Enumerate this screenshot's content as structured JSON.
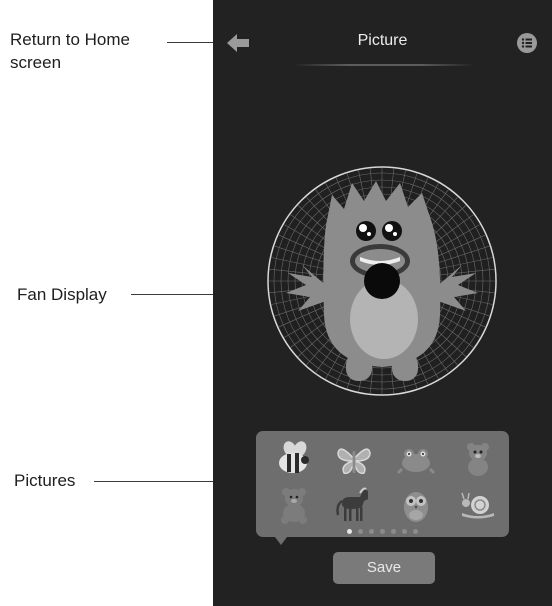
{
  "annotations": {
    "return_home": [
      "Return to Home",
      "screen"
    ],
    "fan_display": "Fan Display",
    "pictures": "Pictures"
  },
  "header": {
    "title": "Picture",
    "back_icon": "back-arrow-icon",
    "menu_icon": "list-icon"
  },
  "fan_display": {
    "image": "monster-picture"
  },
  "pictures": {
    "items": [
      "bee",
      "butterfly",
      "frog",
      "bear",
      "teddy-bear",
      "horse",
      "owl",
      "snail"
    ],
    "pages": 7,
    "active_page": 1
  },
  "save_button": {
    "label": "Save"
  },
  "colors": {
    "screen_bg": "#222222",
    "tray_bg": "#6e6e6e",
    "button_bg": "#7a7a7a",
    "text": "#ececec"
  }
}
